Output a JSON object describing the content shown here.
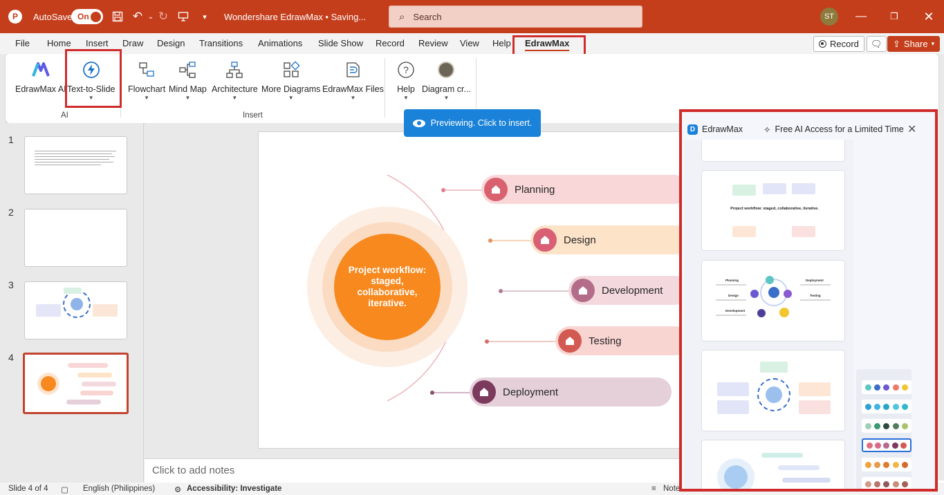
{
  "window": {
    "autosave_label": "AutoSave",
    "autosave_state": "On",
    "title": "Wondershare EdrawMax • Saving...",
    "search_placeholder": "Search",
    "user_initials": "ST"
  },
  "tabs": [
    "File",
    "Home",
    "Insert",
    "Draw",
    "Design",
    "Transitions",
    "Animations",
    "Slide Show",
    "Record",
    "Review",
    "View",
    "Help",
    "EdrawMax"
  ],
  "active_tab": "EdrawMax",
  "ribbon_buttons": {
    "record": "Record",
    "share": "Share"
  },
  "ribbon": {
    "ai_group": {
      "label": "AI",
      "commands": [
        "EdrawMax AI",
        "Text-to-Slide"
      ]
    },
    "insert_group": {
      "label": "Insert",
      "commands": [
        "Flowchart",
        "Mind Map",
        "Architecture",
        "More Diagrams",
        "EdrawMax Files"
      ]
    },
    "other_commands": [
      "Help",
      "Diagram cr..."
    ]
  },
  "preview_tip": "Previewing. Click to insert.",
  "slides": {
    "numbers": [
      "1",
      "2",
      "3",
      "4"
    ],
    "selected": 4
  },
  "slide": {
    "center_text": "Project workflow: staged, collaborative, iterative.",
    "stages": [
      "Planning",
      "Design",
      "Development",
      "Testing",
      "Deployment"
    ]
  },
  "notes_placeholder": "Click to add notes",
  "status": {
    "slide_info": "Slide 4 of 4",
    "language": "English (Philippines)",
    "accessibility": "Accessibility: Investigate",
    "notes": "Note"
  },
  "panel": {
    "brand": "EdrawMax",
    "promo": "Free AI Access for a Limited Time",
    "template_caption": "Project workflow: staged, collaborative, iterative.",
    "template_labels": [
      "Planning",
      "Deployment",
      "Design",
      "Testing",
      "Development"
    ]
  },
  "colors": {
    "office_red": "#c43e1c",
    "highlight_red": "#d02b2b",
    "center_orange": "#f7891f",
    "planning": "#f9d6d8",
    "design": "#fde3c8",
    "development": "#f3d8de",
    "testing": "#f9d5d2",
    "deployment": "#e5cfd9"
  }
}
